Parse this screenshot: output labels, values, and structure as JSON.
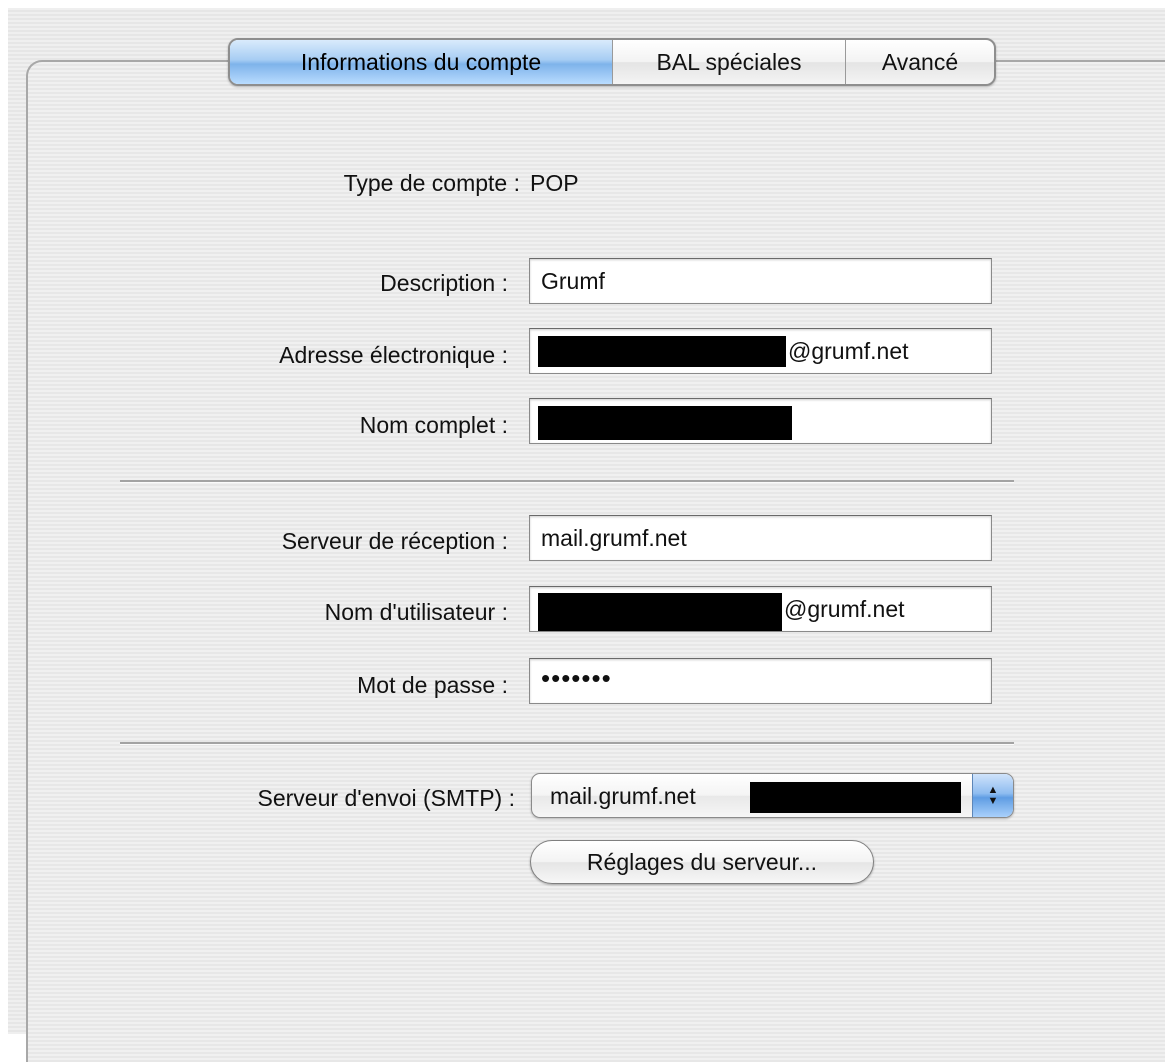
{
  "tabs": [
    {
      "label": "Informations du compte",
      "active": true
    },
    {
      "label": "BAL spéciales",
      "active": false
    },
    {
      "label": "Avancé",
      "active": false
    }
  ],
  "account_type": {
    "label": "Type de compte :",
    "value": "POP"
  },
  "description": {
    "label": "Description :",
    "value": "Grumf"
  },
  "email": {
    "label": "Adresse électronique :",
    "suffix": "@grumf.net"
  },
  "full_name": {
    "label": "Nom complet :"
  },
  "incoming_server": {
    "label": "Serveur de réception :",
    "value": "mail.grumf.net"
  },
  "username": {
    "label": "Nom d'utilisateur :",
    "suffix": "@grumf.net"
  },
  "password": {
    "label": "Mot de passe :",
    "value": "•••••••"
  },
  "smtp": {
    "label": "Serveur d'envoi (SMTP) :",
    "value": "mail.grumf.net"
  },
  "server_settings_button": "Réglages du serveur...",
  "colors": {
    "active_tab": "#8fbdf0",
    "panel_bg": "#ececec",
    "redaction": "#000000"
  }
}
